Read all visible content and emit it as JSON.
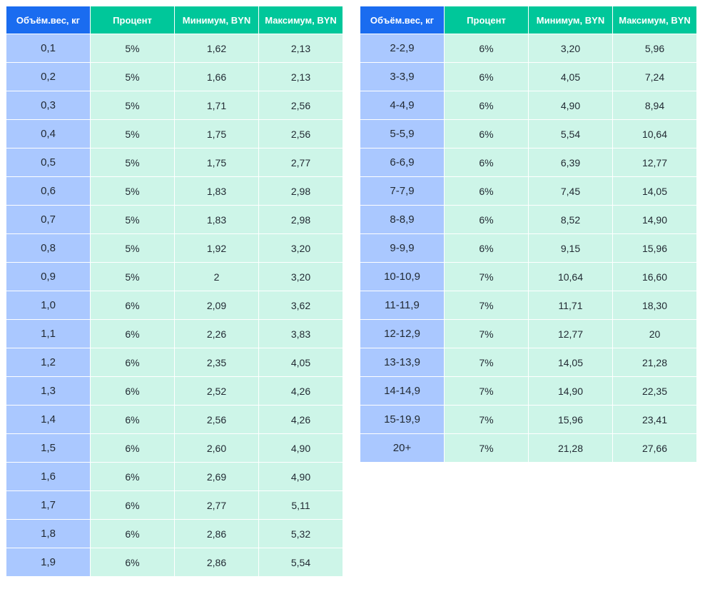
{
  "headers": [
    "Объём.вес, кг",
    "Процент",
    "Минимум, BYN",
    "Максимум, BYN"
  ],
  "left_rows": [
    [
      "0,1",
      "5%",
      "1,62",
      "2,13"
    ],
    [
      "0,2",
      "5%",
      "1,66",
      "2,13"
    ],
    [
      "0,3",
      "5%",
      "1,71",
      "2,56"
    ],
    [
      "0,4",
      "5%",
      "1,75",
      "2,56"
    ],
    [
      "0,5",
      "5%",
      "1,75",
      "2,77"
    ],
    [
      "0,6",
      "5%",
      "1,83",
      "2,98"
    ],
    [
      "0,7",
      "5%",
      "1,83",
      "2,98"
    ],
    [
      "0,8",
      "5%",
      "1,92",
      "3,20"
    ],
    [
      "0,9",
      "5%",
      "2",
      "3,20"
    ],
    [
      "1,0",
      "6%",
      "2,09",
      "3,62"
    ],
    [
      "1,1",
      "6%",
      "2,26",
      "3,83"
    ],
    [
      "1,2",
      "6%",
      "2,35",
      "4,05"
    ],
    [
      "1,3",
      "6%",
      "2,52",
      "4,26"
    ],
    [
      "1,4",
      "6%",
      "2,56",
      "4,26"
    ],
    [
      "1,5",
      "6%",
      "2,60",
      "4,90"
    ],
    [
      "1,6",
      "6%",
      "2,69",
      "4,90"
    ],
    [
      "1,7",
      "6%",
      "2,77",
      "5,11"
    ],
    [
      "1,8",
      "6%",
      "2,86",
      "5,32"
    ],
    [
      "1,9",
      "6%",
      "2,86",
      "5,54"
    ]
  ],
  "right_rows": [
    [
      "2-2,9",
      "6%",
      "3,20",
      "5,96"
    ],
    [
      "3-3,9",
      "6%",
      "4,05",
      "7,24"
    ],
    [
      "4-4,9",
      "6%",
      "4,90",
      "8,94"
    ],
    [
      "5-5,9",
      "6%",
      "5,54",
      "10,64"
    ],
    [
      "6-6,9",
      "6%",
      "6,39",
      "12,77"
    ],
    [
      "7-7,9",
      "6%",
      "7,45",
      "14,05"
    ],
    [
      "8-8,9",
      "6%",
      "8,52",
      "14,90"
    ],
    [
      "9-9,9",
      "6%",
      "9,15",
      "15,96"
    ],
    [
      "10-10,9",
      "7%",
      "10,64",
      "16,60"
    ],
    [
      "11-11,9",
      "7%",
      "11,71",
      "18,30"
    ],
    [
      "12-12,9",
      "7%",
      "12,77",
      "20"
    ],
    [
      "13-13,9",
      "7%",
      "14,05",
      "21,28"
    ],
    [
      "14-14,9",
      "7%",
      "14,90",
      "22,35"
    ],
    [
      "15-19,9",
      "7%",
      "15,96",
      "23,41"
    ],
    [
      "20+",
      "7%",
      "21,28",
      "27,66"
    ]
  ],
  "colors": {
    "header_weight": "#1a6cf0",
    "header_other": "#00c79a",
    "cell_weight": "#aac8ff",
    "cell_other": "#cdf5e8"
  }
}
